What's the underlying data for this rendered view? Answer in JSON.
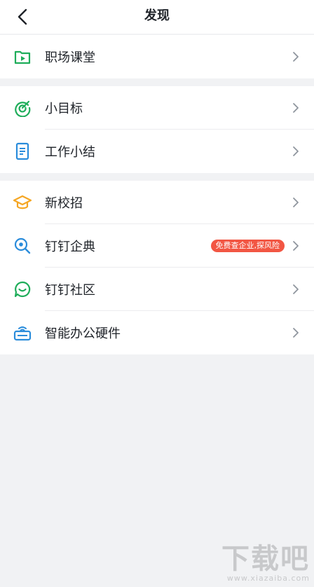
{
  "header": {
    "title": "发现"
  },
  "groups": [
    {
      "items": [
        {
          "label": "职场课堂",
          "icon": "video-folder-icon"
        }
      ]
    },
    {
      "items": [
        {
          "label": "小目标",
          "icon": "target-icon"
        },
        {
          "label": "工作小结",
          "icon": "document-icon"
        }
      ]
    },
    {
      "items": [
        {
          "label": "新校招",
          "icon": "graduation-cap-icon"
        },
        {
          "label": "钉钉企典",
          "icon": "search-magnifier-icon",
          "badge": "免费查企业,探风险"
        },
        {
          "label": "钉钉社区",
          "icon": "chat-bubble-icon"
        },
        {
          "label": "智能办公硬件",
          "icon": "device-icon"
        }
      ]
    }
  ],
  "colors": {
    "green": "#1fad5a",
    "blue": "#2a8cdb",
    "orange": "#f5a623",
    "badge_red": "#f25643"
  },
  "watermark": {
    "main": "下载吧",
    "sub": "www.xiazaiba.com"
  }
}
